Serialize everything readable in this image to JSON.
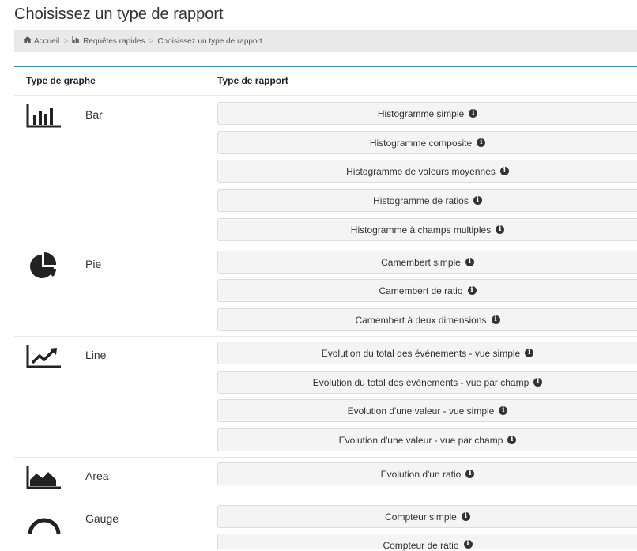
{
  "page": {
    "title": "Choisissez un type de rapport"
  },
  "breadcrumb": {
    "home": "Accueil",
    "quick": "Requêtes rapides",
    "current": "Choisissez un type de rapport",
    "separator": ">"
  },
  "table": {
    "col_graph": "Type de graphe",
    "col_report": "Type de rapport",
    "info_glyph": "i"
  },
  "groups": {
    "bar": {
      "name": "Bar",
      "icon": "bar-chart-icon",
      "reports": [
        "Histogramme simple",
        "Histogramme composite",
        "Histogramme de valeurs moyennes",
        "Histogramme de ratios",
        "Histogramme à champs multiples"
      ]
    },
    "pie": {
      "name": "Pie",
      "icon": "pie-chart-icon",
      "reports": [
        "Camembert simple",
        "Camembert de ratio",
        "Camembert à deux dimensions"
      ]
    },
    "line": {
      "name": "Line",
      "icon": "line-chart-icon",
      "reports": [
        "Evolution du total des événements - vue simple",
        "Evolution du total des événements - vue par champ",
        "Evolution d'une valeur - vue simple",
        "Evolution d'une valeur - vue par champ"
      ]
    },
    "area": {
      "name": "Area",
      "icon": "area-chart-icon",
      "reports": [
        "Evolution d'un ratio"
      ]
    },
    "gauge": {
      "name": "Gauge",
      "icon": "gauge-icon",
      "reports": [
        "Compteur simple",
        "Compteur de ratio"
      ]
    }
  },
  "colors": {
    "accent": "#3c8dbc",
    "button_bg": "#f4f4f4",
    "breadcrumb_bg": "#e9e9ea"
  }
}
